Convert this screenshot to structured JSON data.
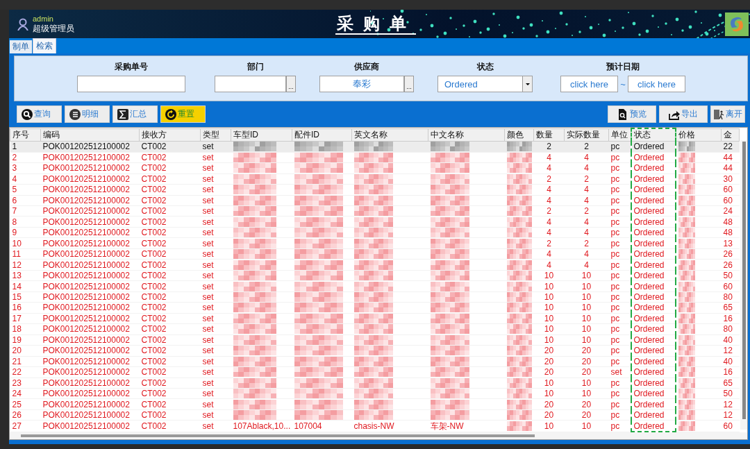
{
  "header": {
    "user_name": "admin",
    "user_role": "超级管理员",
    "title": "采购单"
  },
  "tabs": [
    {
      "label": "制单",
      "selected": false
    },
    {
      "label": "检索",
      "selected": true
    }
  ],
  "filters": [
    {
      "kind": "text",
      "label": "采购单号"
    },
    {
      "kind": "picker",
      "label": "部门",
      "button": "..."
    },
    {
      "kind": "picker",
      "label": "供应商",
      "value": "奉彩",
      "button": "..."
    },
    {
      "kind": "select",
      "label": "状态",
      "value": "Ordered"
    },
    {
      "kind": "daterange",
      "label": "预计日期",
      "from": "click here",
      "separator": "~",
      "to": "click here"
    }
  ],
  "toolbar_left": [
    {
      "label": "查询",
      "kind": "search",
      "highlighted": false
    },
    {
      "label": "明细",
      "kind": "list",
      "highlighted": false
    },
    {
      "label": "汇总",
      "kind": "sum",
      "highlighted": false
    },
    {
      "label": "重置",
      "kind": "reset",
      "highlighted": true
    }
  ],
  "toolbar_right": [
    {
      "label": "预览",
      "kind": "preview"
    },
    {
      "label": "导出",
      "kind": "export"
    },
    {
      "label": "离开",
      "kind": "exit"
    }
  ],
  "table": {
    "columns": [
      {
        "label": "序号",
        "highlighted": false
      },
      {
        "label": "编码",
        "highlighted": false
      },
      {
        "label": "接收方",
        "highlighted": false
      },
      {
        "label": "类型",
        "highlighted": false
      },
      {
        "label": "车型ID",
        "highlighted": false
      },
      {
        "label": "配件ID",
        "highlighted": false
      },
      {
        "label": "英文名称",
        "highlighted": false
      },
      {
        "label": "中文名称",
        "highlighted": false
      },
      {
        "label": "颜色",
        "highlighted": false
      },
      {
        "label": "数量",
        "highlighted": false
      },
      {
        "label": "实际数量",
        "highlighted": false
      },
      {
        "label": "单位",
        "highlighted": false
      },
      {
        "label": "状态",
        "highlighted": true
      },
      {
        "label": "价格",
        "highlighted": false
      },
      {
        "label": "金",
        "highlighted": false
      }
    ],
    "rows": [
      {
        "selected": true,
        "cells": [
          "1",
          "POK001202512100002",
          "CT002",
          "set",
          null,
          null,
          null,
          null,
          null,
          "2",
          "2",
          "pc",
          "Ordered",
          null,
          "22"
        ]
      },
      {
        "selected": false,
        "cells": [
          "2",
          "POK001202512100002",
          "CT002",
          "set",
          null,
          null,
          null,
          null,
          null,
          "4",
          "4",
          "pc",
          "Ordered",
          null,
          "44"
        ]
      },
      {
        "selected": false,
        "cells": [
          "3",
          "POK001202512100002",
          "CT002",
          "set",
          null,
          null,
          null,
          null,
          null,
          "4",
          "4",
          "pc",
          "Ordered",
          null,
          "44"
        ]
      },
      {
        "selected": false,
        "cells": [
          "4",
          "POK001202512100002",
          "CT002",
          "set",
          null,
          null,
          null,
          null,
          null,
          "2",
          "2",
          "pc",
          "Ordered",
          null,
          "30"
        ]
      },
      {
        "selected": false,
        "cells": [
          "5",
          "POK001202512100002",
          "CT002",
          "set",
          null,
          null,
          null,
          null,
          null,
          "4",
          "4",
          "pc",
          "Ordered",
          null,
          "60"
        ]
      },
      {
        "selected": false,
        "cells": [
          "6",
          "POK001202512100002",
          "CT002",
          "set",
          null,
          null,
          null,
          null,
          null,
          "4",
          "4",
          "pc",
          "Ordered",
          null,
          "60"
        ]
      },
      {
        "selected": false,
        "cells": [
          "7",
          "POK001202512100002",
          "CT002",
          "set",
          null,
          null,
          null,
          null,
          null,
          "2",
          "2",
          "pc",
          "Ordered",
          null,
          "24"
        ]
      },
      {
        "selected": false,
        "cells": [
          "8",
          "POK001202512100002",
          "CT002",
          "set",
          null,
          null,
          null,
          null,
          null,
          "4",
          "4",
          "pc",
          "Ordered",
          null,
          "48"
        ]
      },
      {
        "selected": false,
        "cells": [
          "9",
          "POK001202512100002",
          "CT002",
          "set",
          null,
          null,
          null,
          null,
          null,
          "4",
          "4",
          "pc",
          "Ordered",
          null,
          "48"
        ]
      },
      {
        "selected": false,
        "cells": [
          "10",
          "POK001202512100002",
          "CT002",
          "set",
          null,
          null,
          null,
          null,
          null,
          "2",
          "2",
          "pc",
          "Ordered",
          null,
          "13"
        ]
      },
      {
        "selected": false,
        "cells": [
          "11",
          "POK001202512100002",
          "CT002",
          "set",
          null,
          null,
          null,
          null,
          null,
          "4",
          "4",
          "pc",
          "Ordered",
          null,
          "26"
        ]
      },
      {
        "selected": false,
        "cells": [
          "12",
          "POK001202512100002",
          "CT002",
          "set",
          null,
          null,
          null,
          null,
          null,
          "4",
          "4",
          "pc",
          "Ordered",
          null,
          "26"
        ]
      },
      {
        "selected": false,
        "cells": [
          "13",
          "POK001202512100002",
          "CT002",
          "set",
          null,
          null,
          null,
          null,
          null,
          "10",
          "10",
          "pc",
          "Ordered",
          null,
          "50"
        ]
      },
      {
        "selected": false,
        "cells": [
          "14",
          "POK001202512100002",
          "CT002",
          "set",
          null,
          null,
          null,
          null,
          null,
          "10",
          "10",
          "pc",
          "Ordered",
          null,
          "60"
        ]
      },
      {
        "selected": false,
        "cells": [
          "15",
          "POK001202512100002",
          "CT002",
          "set",
          null,
          null,
          null,
          null,
          null,
          "10",
          "10",
          "pc",
          "Ordered",
          null,
          "80"
        ]
      },
      {
        "selected": false,
        "cells": [
          "16",
          "POK001202512100002",
          "CT002",
          "set",
          null,
          null,
          null,
          null,
          null,
          "10",
          "10",
          "pc",
          "Ordered",
          null,
          "65"
        ]
      },
      {
        "selected": false,
        "cells": [
          "17",
          "POK001202512100002",
          "CT002",
          "set",
          null,
          null,
          null,
          null,
          null,
          "10",
          "10",
          "pc",
          "Ordered",
          null,
          "16"
        ]
      },
      {
        "selected": false,
        "cells": [
          "18",
          "POK001202512100002",
          "CT002",
          "set",
          null,
          null,
          null,
          null,
          null,
          "10",
          "10",
          "pc",
          "Ordered",
          null,
          "80"
        ]
      },
      {
        "selected": false,
        "cells": [
          "19",
          "POK001202512100002",
          "CT002",
          "set",
          null,
          null,
          null,
          null,
          null,
          "10",
          "10",
          "pc",
          "Ordered",
          null,
          "40"
        ]
      },
      {
        "selected": false,
        "cells": [
          "20",
          "POK001202512100002",
          "CT002",
          "set",
          null,
          null,
          null,
          null,
          null,
          "20",
          "20",
          "pc",
          "Ordered",
          null,
          "12"
        ]
      },
      {
        "selected": false,
        "cells": [
          "21",
          "POK001202512100002",
          "CT002",
          "set",
          null,
          null,
          null,
          null,
          null,
          "20",
          "20",
          "pc",
          "Ordered",
          null,
          "40"
        ]
      },
      {
        "selected": false,
        "cells": [
          "22",
          "POK001202512100002",
          "CT002",
          "set",
          null,
          null,
          null,
          null,
          null,
          "20",
          "20",
          "set",
          "Ordered",
          null,
          "16"
        ]
      },
      {
        "selected": false,
        "cells": [
          "23",
          "POK001202512100002",
          "CT002",
          "set",
          null,
          null,
          null,
          null,
          null,
          "10",
          "10",
          "pc",
          "Ordered",
          null,
          "65"
        ]
      },
      {
        "selected": false,
        "cells": [
          "24",
          "POK001202512100002",
          "CT002",
          "set",
          null,
          null,
          null,
          null,
          null,
          "10",
          "10",
          "pc",
          "Ordered",
          null,
          "50"
        ]
      },
      {
        "selected": false,
        "cells": [
          "25",
          "POK001202512100002",
          "CT002",
          "set",
          null,
          null,
          null,
          null,
          null,
          "20",
          "20",
          "pc",
          "Ordered",
          null,
          "12"
        ]
      },
      {
        "selected": false,
        "cells": [
          "26",
          "POK001202512100002",
          "CT002",
          "set",
          null,
          null,
          null,
          null,
          null,
          "20",
          "20",
          "pc",
          "Ordered",
          null,
          "12"
        ]
      },
      {
        "selected": false,
        "cells": [
          "27",
          "POK001202512100002",
          "CT002",
          "set",
          "107Ablack,10...",
          "107004",
          "chasis-NW",
          "车架-NW",
          null,
          "10",
          "10",
          "pc",
          "Ordered",
          null,
          "60"
        ]
      }
    ]
  }
}
